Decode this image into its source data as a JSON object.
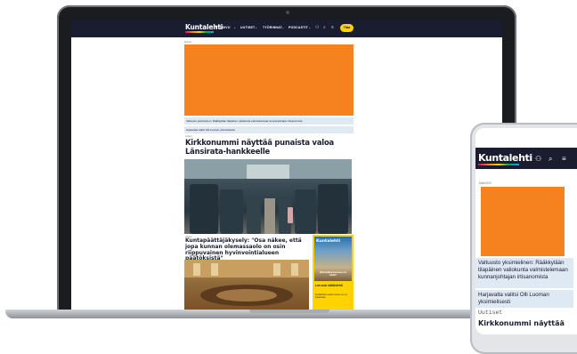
{
  "site": {
    "logo": "Kuntalehti",
    "nav": [
      "ETUSIVU",
      "UUTISET",
      "TYÖRINNAT",
      "PODCASTIT"
    ],
    "subscribe_label": "Tilaa",
    "ad_label": "Mainos"
  },
  "tickers": [
    "Valtuusto yksimielinen: Rääkkylään tilapäinen valiokunta valmistelemaan kunnanjohtajan irtisanomista",
    "Harjavalta valitsi Olli Luoman yksimielisesti"
  ],
  "articles": [
    {
      "kicker": "Uutiset",
      "title": "Kirkkonummi näyttää punaista valoa Länsirata-hankkeelle"
    },
    {
      "kicker": "Uutiset",
      "title": "Kuntapäättäjäkysely: \"Osa näkee, että jopa kunnan olemassaolo on osin riippuvainen hyvinvointialueen päätöksistä\""
    }
  ],
  "magazine": {
    "logo": "Kuntalehti",
    "cover_line": "Mitä kaikkea kunnassa voi tehdä?",
    "title": "Lue uusi näköislehti",
    "desc": "Kuntalehden uusin numero on nyt luettavissa"
  },
  "phone": {
    "logo": "Kuntalehti",
    "ad_label": "MAINOS",
    "kicker": "Uutiset",
    "headline": "Kirkkonummi näyttää"
  },
  "colors": {
    "navy": "#1a1c30",
    "ad_orange": "#f5821f",
    "ticker_bg": "#dfe9f4",
    "accent_yellow": "#ffd200"
  }
}
